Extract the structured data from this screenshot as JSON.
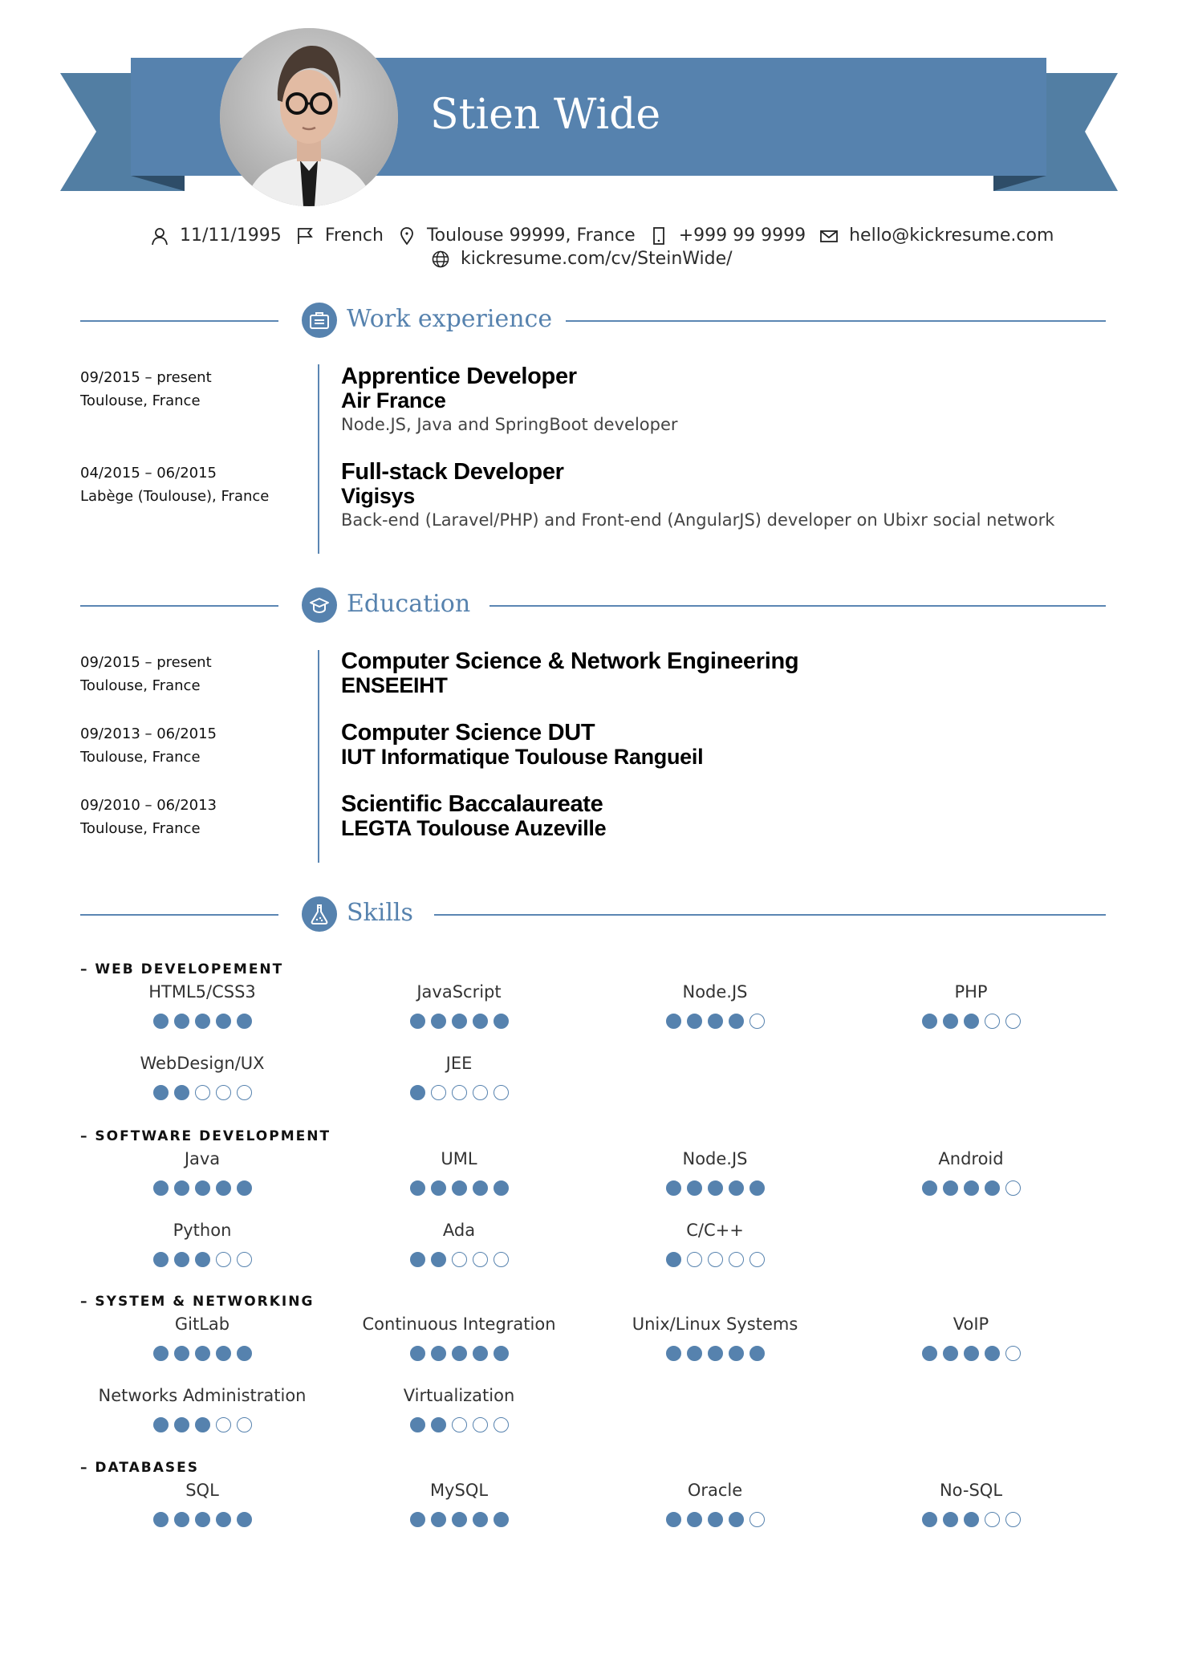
{
  "header": {
    "name": "Stien Wide",
    "photo_alt": "profile-photo",
    "colors": {
      "band": "#5682ae",
      "tail": "#527ea3",
      "fold": "#2e4d68",
      "accent": "#5682ae"
    }
  },
  "contact": {
    "birthdate": {
      "icon": "person-icon",
      "value": "11/11/1995"
    },
    "nationality": {
      "icon": "flag-icon",
      "value": "French"
    },
    "address": {
      "icon": "location-pin-icon",
      "value": "Toulouse 99999, France"
    },
    "phone": {
      "icon": "phone-icon",
      "value": "+999 99 9999"
    },
    "email": {
      "icon": "envelope-icon",
      "value": "hello@kickresume.com"
    },
    "website": {
      "icon": "globe-icon",
      "value": "kickresume.com/cv/SteinWide/"
    }
  },
  "sections": {
    "work": {
      "title": "Work experience",
      "icon": "briefcase-icon",
      "entries": [
        {
          "dates": "09/2015 – present",
          "location": "Toulouse, France",
          "title": "Apprentice Developer",
          "company": "Air France",
          "description": "Node.JS, Java and SpringBoot developer"
        },
        {
          "dates": "04/2015 – 06/2015",
          "location": "Labège (Toulouse), France",
          "title": "Full-stack Developer",
          "company": "Vigisys",
          "description": "Back-end (Laravel/PHP) and Front-end (AngularJS) developer on Ubixr social network"
        }
      ]
    },
    "education": {
      "title": "Education",
      "icon": "graduation-cap-icon",
      "entries": [
        {
          "dates": "09/2015 – present",
          "location": "Toulouse, France",
          "degree": "Computer Science & Network Engineering",
          "school": "ENSEEIHT"
        },
        {
          "dates": "09/2013 – 06/2015",
          "location": "Toulouse, France",
          "degree": "Computer Science DUT",
          "school": "IUT Informatique Toulouse Rangueil"
        },
        {
          "dates": "09/2010 – 06/2013",
          "location": "Toulouse, France",
          "degree": "Scientific Baccalaureate",
          "school": "LEGTA Toulouse Auzeville"
        }
      ]
    },
    "skills": {
      "title": "Skills",
      "icon": "flask-icon",
      "max_rating": 5,
      "categories": [
        {
          "label": "– WEB DEVELOPEMENT",
          "items": [
            {
              "name": "HTML5/CSS3",
              "rating": 5
            },
            {
              "name": "JavaScript",
              "rating": 5
            },
            {
              "name": "Node.JS",
              "rating": 4
            },
            {
              "name": "PHP",
              "rating": 3
            },
            {
              "name": "WebDesign/UX",
              "rating": 2
            },
            {
              "name": "JEE",
              "rating": 1
            }
          ]
        },
        {
          "label": "– SOFTWARE DEVELOPMENT",
          "items": [
            {
              "name": "Java",
              "rating": 5
            },
            {
              "name": "UML",
              "rating": 5
            },
            {
              "name": "Node.JS",
              "rating": 5
            },
            {
              "name": "Android",
              "rating": 4
            },
            {
              "name": "Python",
              "rating": 3
            },
            {
              "name": "Ada",
              "rating": 2
            },
            {
              "name": "C/C++",
              "rating": 1
            }
          ]
        },
        {
          "label": "– SYSTEM & NETWORKING",
          "items": [
            {
              "name": "GitLab",
              "rating": 5
            },
            {
              "name": "Continuous Integration",
              "rating": 5
            },
            {
              "name": "Unix/Linux Systems",
              "rating": 5
            },
            {
              "name": "VoIP",
              "rating": 4
            },
            {
              "name": "Networks Administration",
              "rating": 3
            },
            {
              "name": "Virtualization",
              "rating": 2
            }
          ]
        },
        {
          "label": "– DATABASES",
          "items": [
            {
              "name": "SQL",
              "rating": 5
            },
            {
              "name": "MySQL",
              "rating": 5
            },
            {
              "name": "Oracle",
              "rating": 4
            },
            {
              "name": "No-SQL",
              "rating": 3
            }
          ]
        }
      ]
    }
  }
}
